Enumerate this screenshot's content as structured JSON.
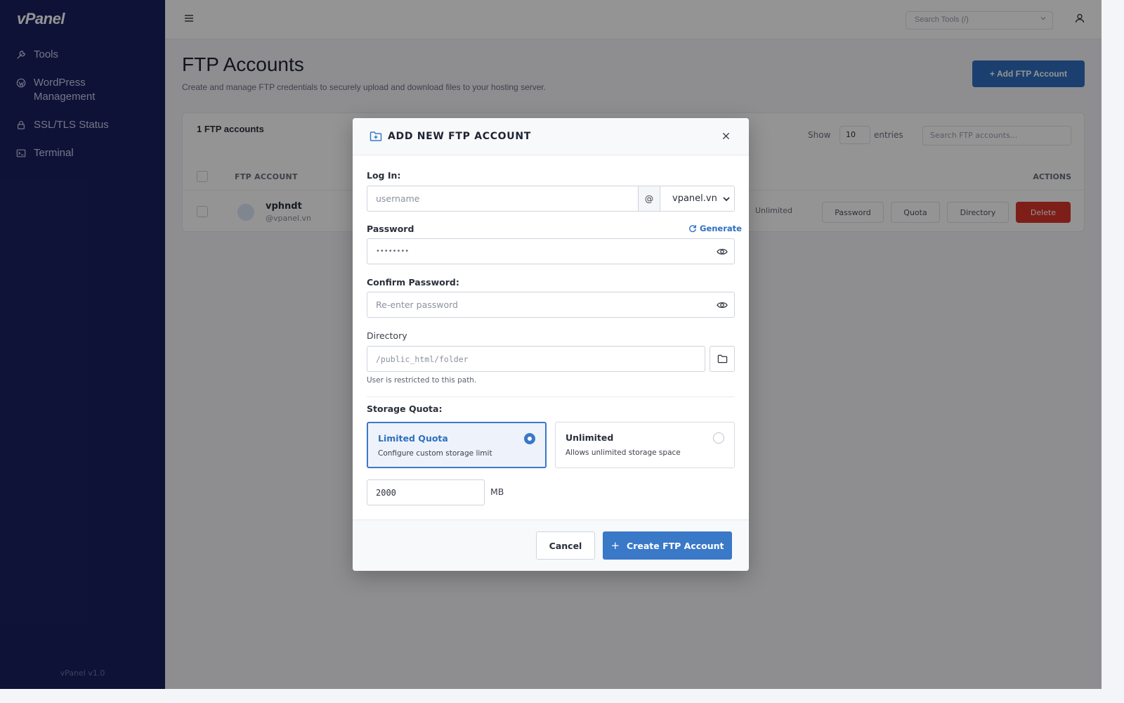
{
  "sidebar": {
    "logo": "vPanel",
    "items": [
      {
        "label": "Tools",
        "icon": "wrench-icon"
      },
      {
        "label": "WordPress Management",
        "icon": "wordpress-icon"
      },
      {
        "label": "SSL/TLS Status",
        "icon": "lock-icon"
      },
      {
        "label": "Terminal",
        "icon": "terminal-icon"
      }
    ],
    "version": "vPanel v1.0"
  },
  "topbar": {
    "search_placeholder": "Search Tools (/)"
  },
  "page": {
    "title": "FTP Accounts",
    "subtitle": "Create and manage FTP credentials to securely upload and download files to your hosting server.",
    "add_button": "+ Add FTP Account"
  },
  "accounts_card": {
    "count_label": "1 FTP accounts",
    "show_label": "Show",
    "show_value": "10",
    "entries_label": "entries",
    "search_placeholder": "Search FTP accounts...",
    "columns": {
      "account": "FTP ACCOUNT",
      "actions": "ACTIONS"
    },
    "rows": [
      {
        "user": "vphndt",
        "domain": "@vpanel.vn",
        "quota": "Unlimited",
        "actions": [
          "Password",
          "Quota",
          "Directory"
        ],
        "delete_label": "Delete"
      }
    ]
  },
  "modal": {
    "title": "ADD NEW FTP ACCOUNT",
    "login_label": "Log In:",
    "username_placeholder": "username",
    "at_symbol": "@",
    "domain_selected": "vpanel.vn",
    "password_label": "Password",
    "generate_label": "Generate",
    "password_masked": "••••••••",
    "confirm_label": "Confirm Password:",
    "confirm_placeholder": "Re-enter password",
    "directory_label": "Directory",
    "directory_placeholder": "/public_html/folder",
    "directory_hint": "User is restricted to this path.",
    "quota_label": "Storage Quota:",
    "quota_options": [
      {
        "title": "Limited Quota",
        "desc": "Configure custom storage limit",
        "selected": true
      },
      {
        "title": "Unlimited",
        "desc": "Allows unlimited storage space",
        "selected": false
      }
    ],
    "quota_value": "2000",
    "quota_unit": "MB",
    "cancel_label": "Cancel",
    "create_label": "Create FTP Account",
    "create_icon": "+"
  },
  "colors": {
    "sidebar_bg": "#1a2060",
    "primary": "#3a78c8",
    "danger": "#d9342b"
  }
}
